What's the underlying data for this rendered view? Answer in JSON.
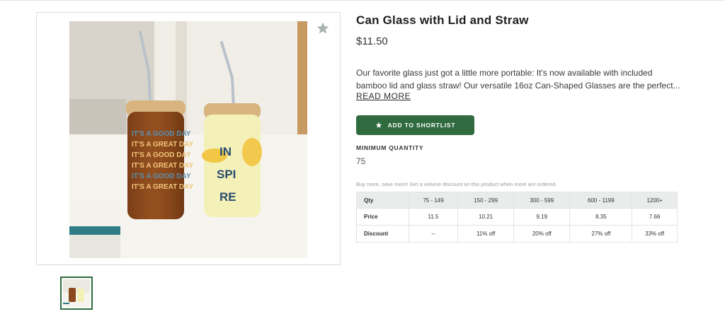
{
  "product": {
    "title": "Can Glass with Lid and Straw",
    "price": "$11.50",
    "description": "Our favorite glass just got a little more portable: It's now available with included bamboo lid and glass straw! Our versatile 16oz Can-Shaped Glasses are the perfect...",
    "read_more": "READ MORE"
  },
  "image": {
    "left_glass_lines": [
      "IT'S A GOOD DAY",
      "IT'S A GREAT DAY",
      "IT'S A GOOD DAY",
      "IT'S A GREAT DAY",
      "IT'S A GOOD DAY",
      "IT'S A GREAT DAY"
    ],
    "right_glass_lines": [
      "IN",
      "SPI",
      "RE"
    ]
  },
  "actions": {
    "shortlist_label": "ADD TO SHORTLIST",
    "favorite_icon": "star-outline-icon"
  },
  "minimum_quantity": {
    "label": "MINIMUM QUANTITY",
    "value": "75"
  },
  "bulk": {
    "note": "Buy more, save more! Get a volume discount on this product when more are ordered.",
    "header": [
      "Qty",
      "75 - 149",
      "150 - 299",
      "300 - 599",
      "600 - 1199",
      "1200+"
    ],
    "price_row": [
      "Price",
      "11.5",
      "10.21",
      "9.19",
      "8.35",
      "7.66"
    ],
    "discount_row": [
      "Discount",
      "--",
      "11% off",
      "20% off",
      "27% off",
      "33% off"
    ]
  },
  "colors": {
    "brand_green": "#2f6b3e",
    "table_header_bg": "#e9ecea"
  }
}
